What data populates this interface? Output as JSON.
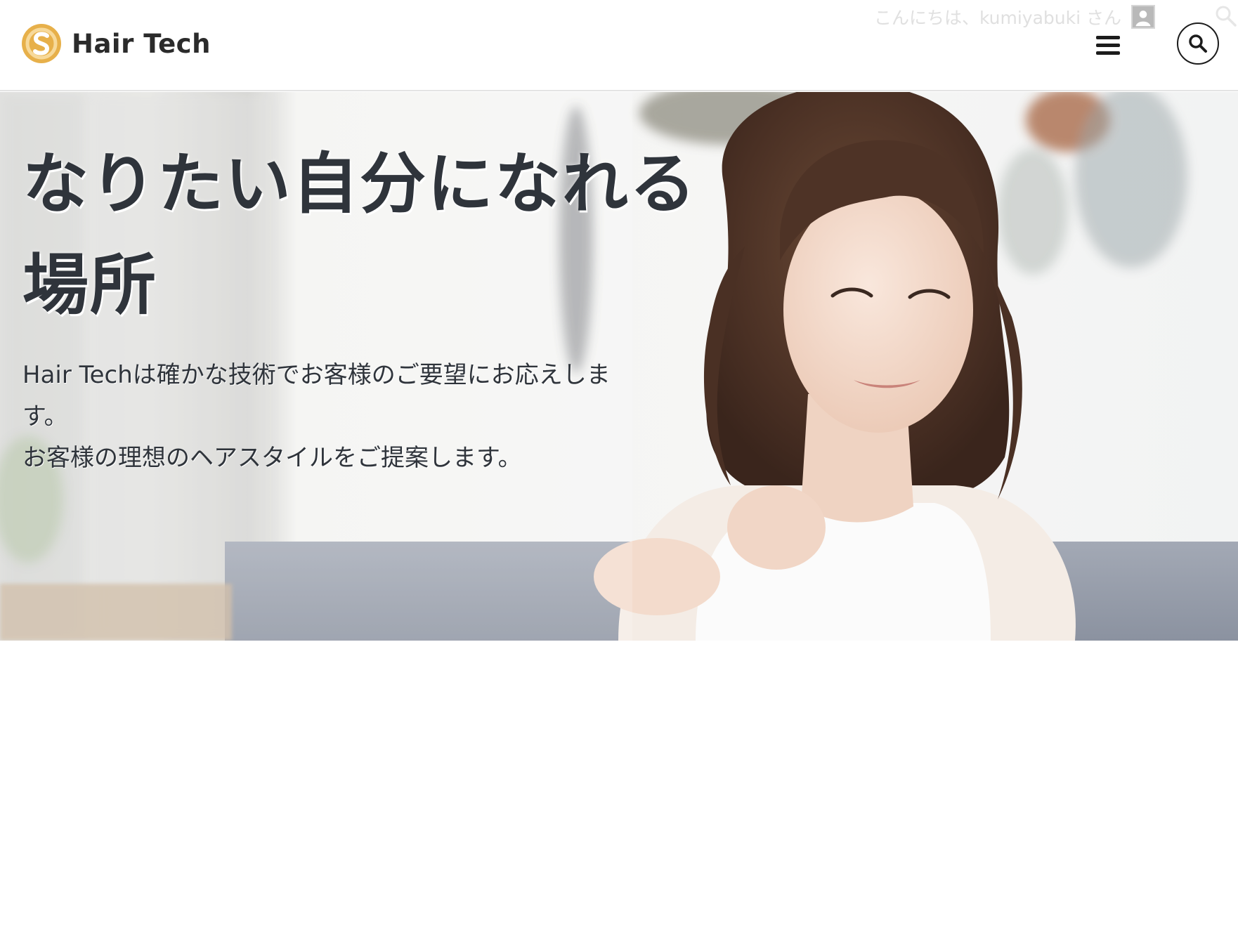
{
  "header": {
    "brand_name": "Hair Tech",
    "greeting": "こんにちは、kumiyabuki さん"
  },
  "hero": {
    "title": "なりたい自分になれる場所",
    "lead_lines": [
      "Hair Techは確かな技術でお客様のご要望にお応えします。",
      "お客様の理想のヘアスタイルをご提案します。"
    ]
  },
  "icons": {
    "logo": "brand-logo-icon",
    "avatar": "user-avatar-icon",
    "mini_search": "search-icon",
    "menu": "hamburger-menu-icon",
    "search": "search-icon"
  },
  "colors": {
    "brand_gold": "#e7b04a",
    "text_dark": "#2f343b",
    "header_border": "#e3e3e3"
  }
}
